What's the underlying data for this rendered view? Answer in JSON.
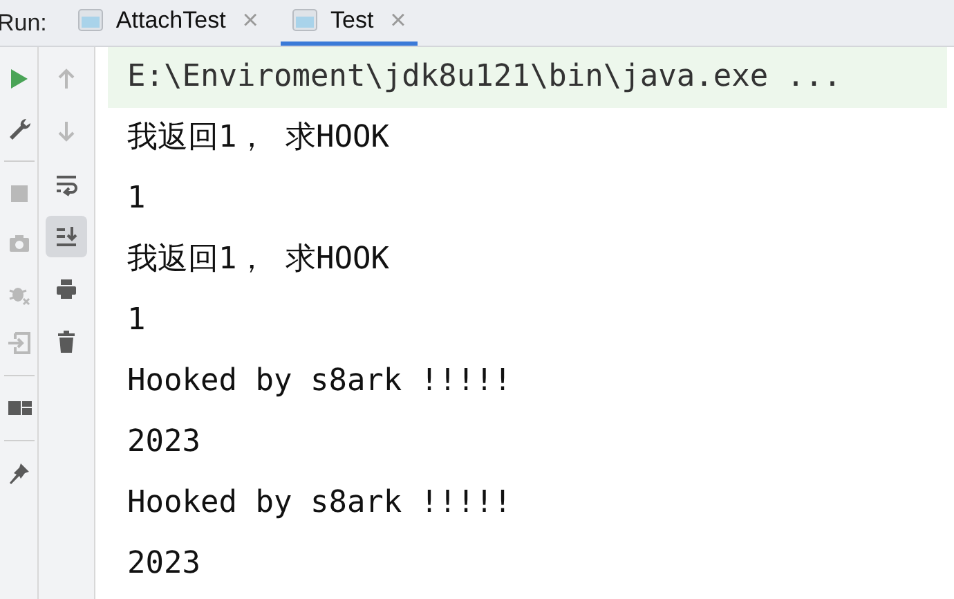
{
  "run_label": "Run:",
  "tabs": [
    {
      "label": "AttachTest",
      "close": "×",
      "selected": false
    },
    {
      "label": "Test",
      "close": "×",
      "selected": true
    }
  ],
  "left_tools": [
    {
      "kind": "run",
      "disabled": false
    },
    {
      "kind": "wrench",
      "disabled": false
    },
    {
      "kind": "sep"
    },
    {
      "kind": "stop",
      "disabled": true
    },
    {
      "kind": "camera",
      "disabled": true
    },
    {
      "kind": "bug",
      "disabled": true
    },
    {
      "kind": "login",
      "disabled": true
    },
    {
      "kind": "sep"
    },
    {
      "kind": "layout",
      "disabled": false
    },
    {
      "kind": "sep"
    },
    {
      "kind": "pin",
      "disabled": false
    }
  ],
  "console_tools": [
    {
      "kind": "up",
      "disabled": true,
      "selected": false
    },
    {
      "kind": "down",
      "disabled": true,
      "selected": false
    },
    {
      "kind": "wrap",
      "disabled": false,
      "selected": false
    },
    {
      "kind": "scroll",
      "disabled": false,
      "selected": true
    },
    {
      "kind": "print",
      "disabled": false,
      "selected": false
    },
    {
      "kind": "trash",
      "disabled": false,
      "selected": false
    }
  ],
  "console": [
    {
      "text": "E:\\Enviroment\\jdk8u121\\bin\\java.exe ...",
      "kind": "command"
    },
    {
      "text": "我返回1， 求HOOK",
      "kind": "output"
    },
    {
      "text": "1",
      "kind": "output"
    },
    {
      "text": "我返回1， 求HOOK",
      "kind": "output"
    },
    {
      "text": "1",
      "kind": "output"
    },
    {
      "text": "Hooked by s8ark !!!!!",
      "kind": "output"
    },
    {
      "text": "2023",
      "kind": "output"
    },
    {
      "text": "Hooked by s8ark !!!!!",
      "kind": "output"
    },
    {
      "text": "2023",
      "kind": "output"
    }
  ]
}
